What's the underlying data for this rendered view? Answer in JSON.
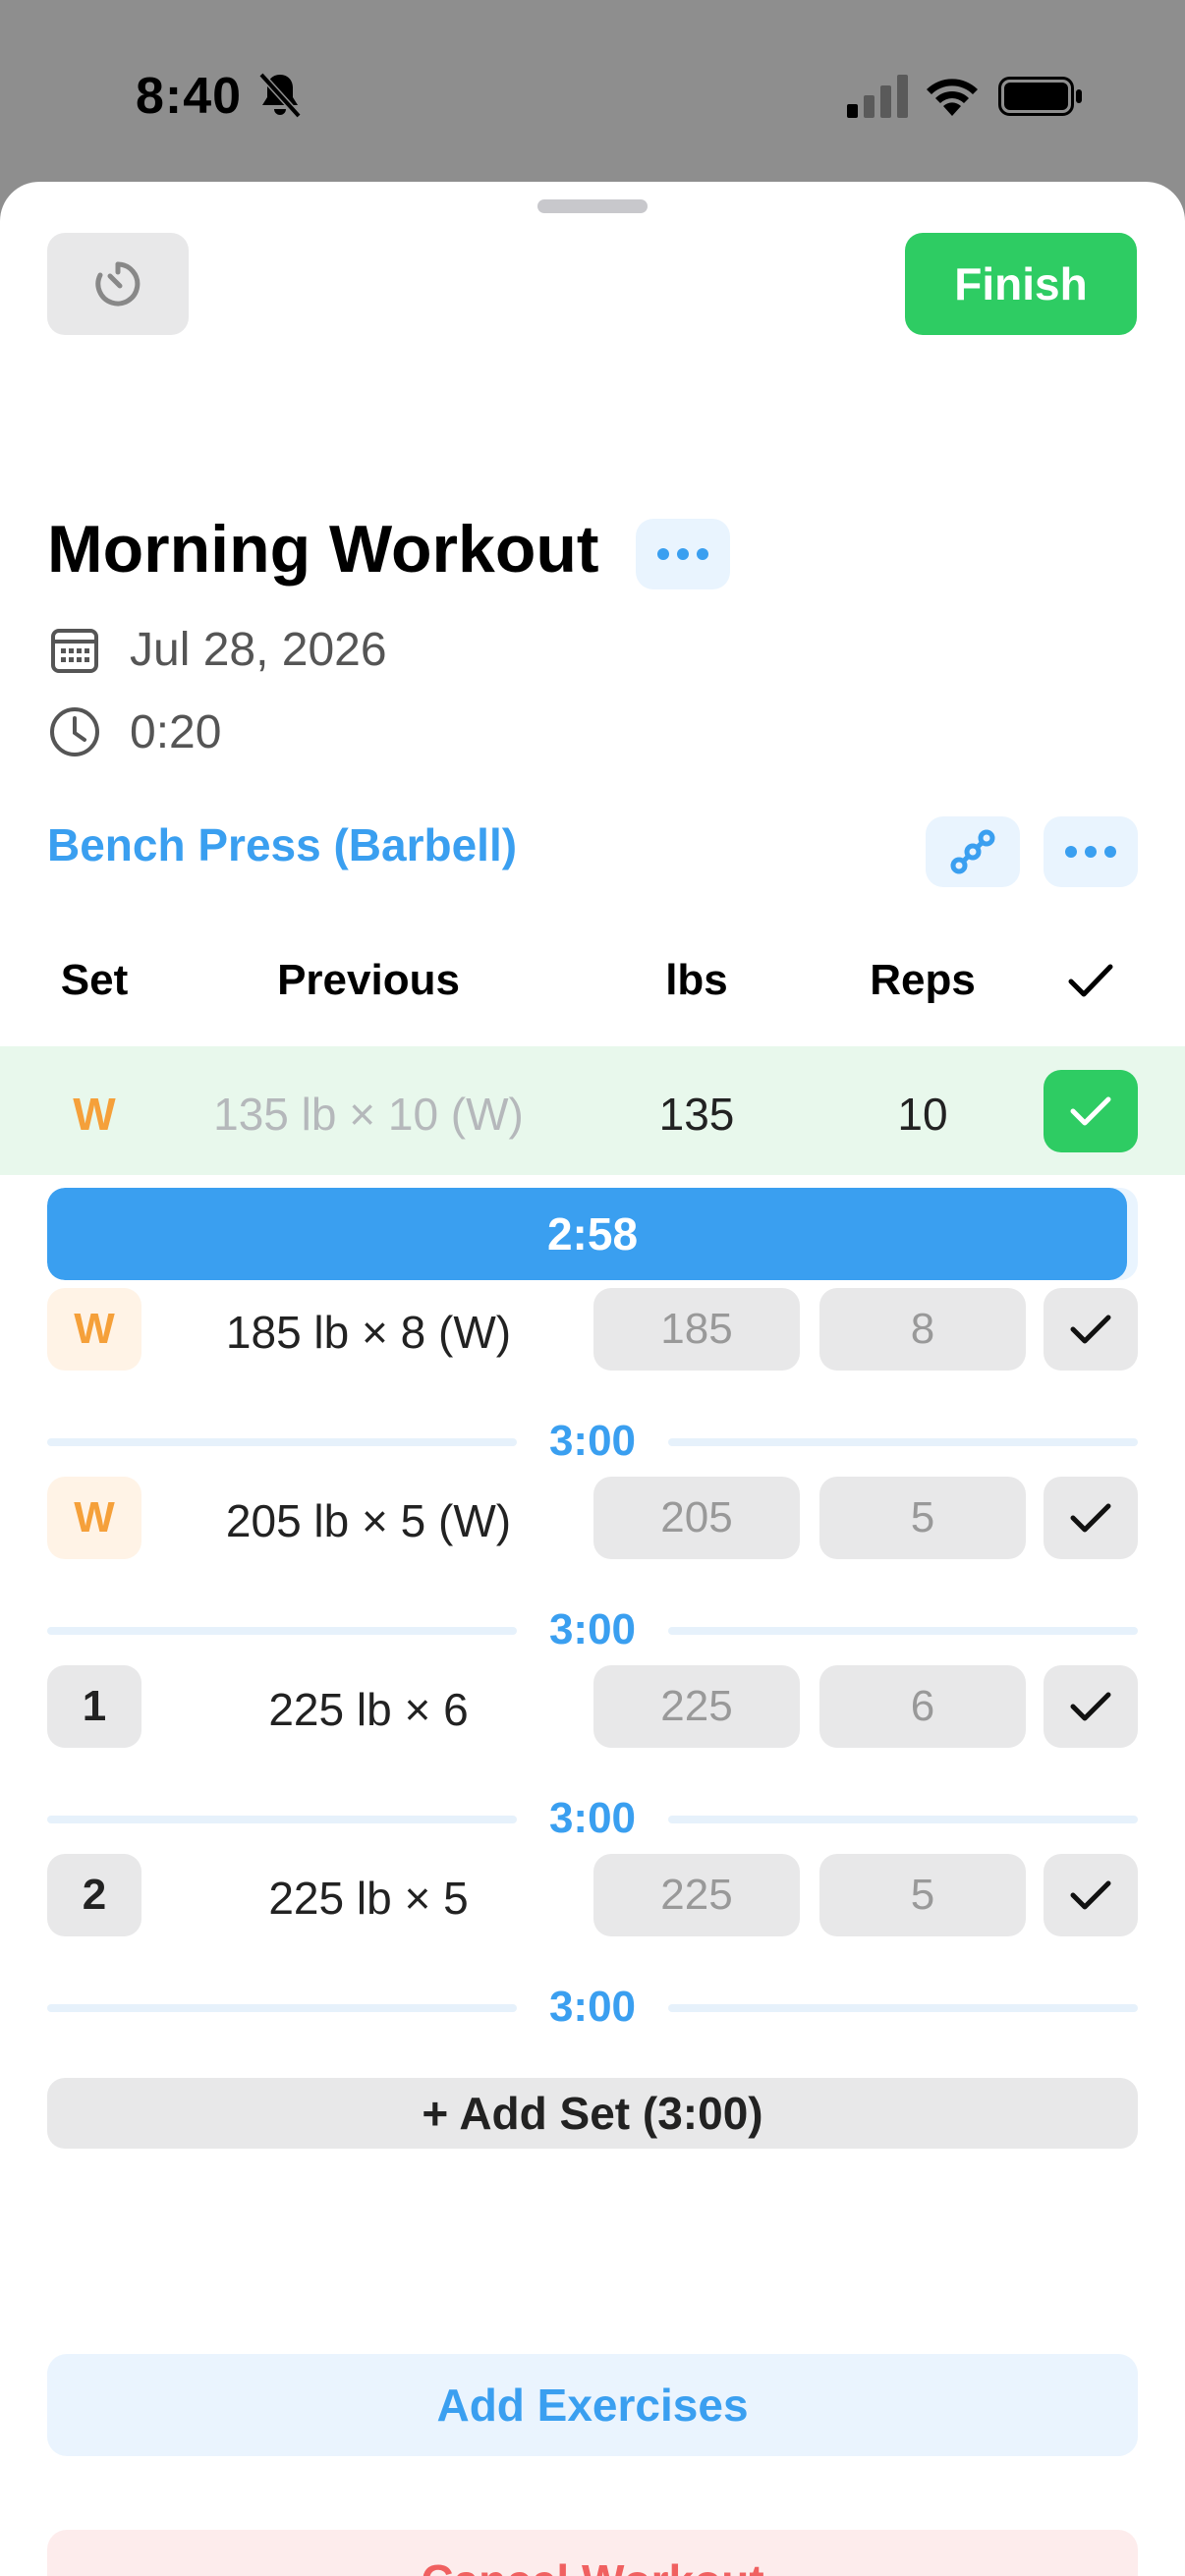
{
  "status_bar": {
    "time": "8:40"
  },
  "header": {
    "finish_label": "Finish"
  },
  "workout": {
    "title": "Morning Workout",
    "date": "Jul 28, 2026",
    "duration": "0:20"
  },
  "exercise": {
    "name": "Bench Press (Barbell)",
    "columns": {
      "set": "Set",
      "previous": "Previous",
      "weight": "lbs",
      "reps": "Reps"
    },
    "completed_set": {
      "set": "W",
      "previous": "135 lb × 10 (W)",
      "weight": "135",
      "reps": "10"
    },
    "active_rest": {
      "label": "2:58",
      "progress": 0.99
    },
    "sets": [
      {
        "set": "W",
        "previous": "185 lb × 8 (W)",
        "weight_placeholder": "185",
        "reps_placeholder": "8",
        "rest": "3:00",
        "warmup": true
      },
      {
        "set": "W",
        "previous": "205 lb × 5 (W)",
        "weight_placeholder": "205",
        "reps_placeholder": "5",
        "rest": "3:00",
        "warmup": true
      },
      {
        "set": "1",
        "previous": "225 lb × 6",
        "weight_placeholder": "225",
        "reps_placeholder": "6",
        "rest": "3:00",
        "warmup": false
      },
      {
        "set": "2",
        "previous": "225 lb × 5",
        "weight_placeholder": "225",
        "reps_placeholder": "5",
        "rest": "3:00",
        "warmup": false
      }
    ],
    "add_set_label": "+ Add Set (3:00)"
  },
  "actions": {
    "add_exercises": "Add Exercises",
    "cancel_workout": "Cancel Workout"
  }
}
